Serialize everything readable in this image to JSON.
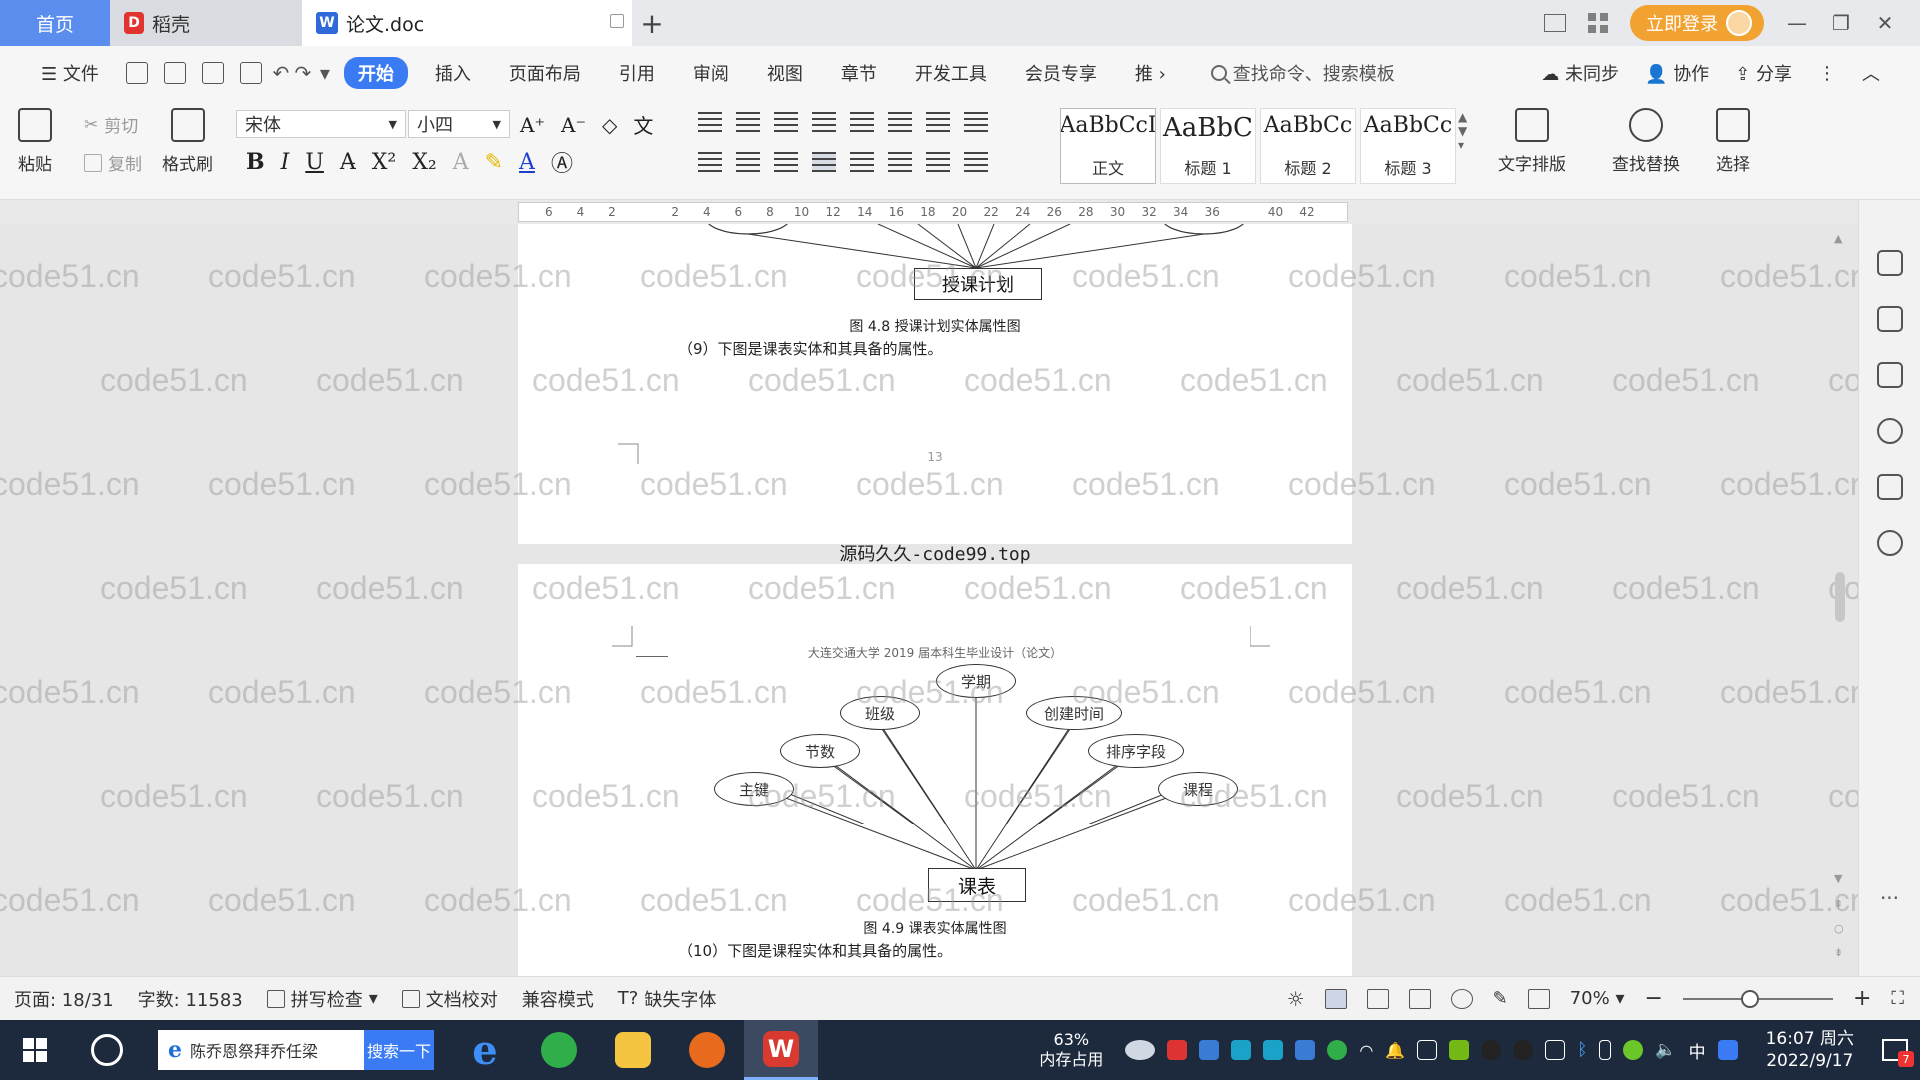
{
  "titlebar": {
    "tabs": [
      {
        "label": "首页"
      },
      {
        "label": "稻壳"
      },
      {
        "label": "论文.doc"
      }
    ],
    "login_label": "立即登录"
  },
  "menubar": {
    "file_label": "文件",
    "items": [
      "开始",
      "插入",
      "页面布局",
      "引用",
      "审阅",
      "视图",
      "章节",
      "开发工具",
      "会员专享",
      "推"
    ],
    "search_placeholder": "查找命令、搜索模板",
    "sync_label": "未同步",
    "collab_label": "协作",
    "share_label": "分享"
  },
  "ribbon": {
    "paste_label": "粘贴",
    "cut_label": "剪切",
    "copy_label": "复制",
    "format_painter_label": "格式刷",
    "font_name": "宋体",
    "font_size": "小四",
    "styles": [
      {
        "preview": "AaBbCcI",
        "name": "正文"
      },
      {
        "preview": "AaBbC",
        "name": "标题 1"
      },
      {
        "preview": "AaBbCc",
        "name": "标题 2"
      },
      {
        "preview": "AaBbCc",
        "name": "标题 3"
      }
    ],
    "text_layout_label": "文字排版",
    "find_replace_label": "查找替换",
    "select_label": "选择"
  },
  "ruler": {
    "ticks": [
      "6",
      "4",
      "2",
      "",
      "2",
      "4",
      "6",
      "8",
      "10",
      "12",
      "14",
      "16",
      "18",
      "20",
      "22",
      "24",
      "26",
      "28",
      "30",
      "32",
      "34",
      "36",
      "",
      "40",
      "42"
    ]
  },
  "document": {
    "page1": {
      "entity_title": "授课计划",
      "caption": "图 4.8 授课计划实体属性图",
      "paragraph": "（9）下图是课表实体和其具备的属性。",
      "page_number": "13"
    },
    "between_pages_text": "源码久久-code99.top",
    "page2": {
      "header": "大连交通大学 2019 届本科生毕业设计（论文）",
      "entity_title": "课表",
      "attributes": [
        "学期",
        "班级",
        "创建时间",
        "节数",
        "排序字段",
        "主键",
        "课程"
      ],
      "caption": "图 4.9 课表实体属性图",
      "paragraph": "（10）下图是课程实体和其具备的属性。"
    },
    "watermark_text": "code51.cn"
  },
  "statusbar": {
    "page": "页面: 18/31",
    "word_count": "字数: 11583",
    "spell_check": "拼写检查",
    "doc_proof": "文档校对",
    "compat_mode": "兼容模式",
    "missing_font": "缺失字体",
    "zoom": "70%"
  },
  "taskbar": {
    "search_text": "陈乔恩祭拜乔任梁",
    "search_button": "搜索一下",
    "memory_percent": "63%",
    "memory_label": "内存占用",
    "ime": "中",
    "time": "16:07 周六",
    "date": "2022/9/17",
    "notification_count": "7"
  }
}
